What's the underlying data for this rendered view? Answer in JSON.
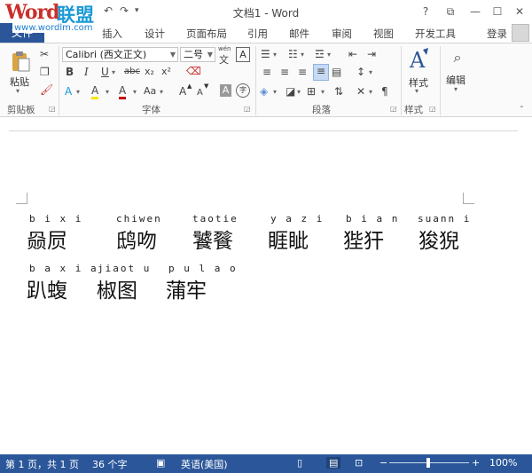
{
  "window": {
    "title": "文档1 - Word",
    "logo_word": "Word",
    "logo_cn": "联盟",
    "logo_url": "www.wordlm.com",
    "help": "?",
    "restore_ribbon": "⧉",
    "minimize": "—",
    "maximize": "☐",
    "close": "✕"
  },
  "tabs": {
    "file": "文件",
    "items": [
      "插入",
      "设计",
      "页面布局",
      "引用",
      "邮件",
      "审阅",
      "视图",
      "开发工具"
    ],
    "login": "登录"
  },
  "ribbon": {
    "clipboard": {
      "paste_label": "粘贴",
      "group_label": "剪贴板"
    },
    "font": {
      "font_name": "Calibri (西文正文)",
      "font_size": "二号",
      "wen_icon": "wén",
      "wen_char": "文",
      "a_box": "A",
      "bold": "B",
      "italic": "I",
      "underline": "U",
      "strike": "abc",
      "subscript": "x₂",
      "superscript": "x²",
      "change_case": "Aa",
      "grow": "A",
      "shrink": "A",
      "highlight": "A",
      "char_shade": "A",
      "enclose": "字",
      "group_label": "字体"
    },
    "paragraph": {
      "group_label": "段落"
    },
    "styles": {
      "label": "样式",
      "group_label": "样式"
    },
    "editing": {
      "label": "编辑"
    }
  },
  "document": {
    "rows": [
      [
        {
          "pinyin": "b i x i",
          "hanzi": "赑屃"
        },
        {
          "pinyin": "chiwen",
          "hanzi": "鸱吻"
        },
        {
          "pinyin": "taotie",
          "hanzi": "饕餮"
        },
        {
          "pinyin": "y a z i",
          "hanzi": "睚眦"
        },
        {
          "pinyin": "b i a n",
          "hanzi": "狴犴"
        },
        {
          "pinyin": "suann i",
          "hanzi": "狻猊"
        }
      ],
      [
        {
          "pinyin": "b a x i a",
          "hanzi": "趴蝮"
        },
        {
          "pinyin": "jiaot u",
          "hanzi": "椒图"
        },
        {
          "pinyin": "p u l a o",
          "hanzi": "蒲牢"
        }
      ]
    ]
  },
  "status": {
    "page": "第 1 页，共 1 页",
    "words": "36 个字",
    "language": "英语(美国)",
    "zoom_minus": "−",
    "zoom_plus": "+",
    "zoom": "100%",
    "zoom_level": 1.0
  },
  "colors": {
    "accent": "#2b579a",
    "logo_red": "#c9302c",
    "logo_blue": "#1b9ad6"
  }
}
